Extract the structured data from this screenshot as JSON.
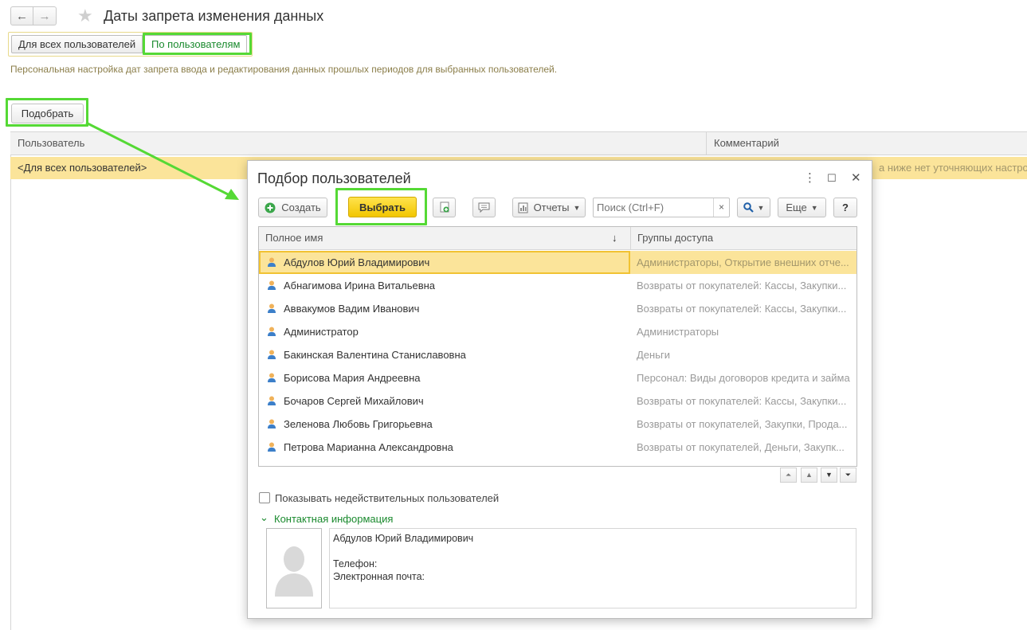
{
  "window": {
    "title": "Даты запрета изменения данных",
    "nav_back": "←",
    "nav_forward": "→",
    "star": "★"
  },
  "mode_switch": {
    "all_users": "Для всех пользователей",
    "by_users": "По пользователям"
  },
  "description": "Персональная настройка дат запрета ввода и редактирования данных прошлых периодов для выбранных пользователей.",
  "pick_button": "Подобрать",
  "main_table": {
    "col_user": "Пользователь",
    "col_comment": "Комментарий",
    "row_user": "<Для всех пользователей>",
    "row_comment": "а ниже нет уточняющих настрое"
  },
  "dialog": {
    "title": "Подбор пользователей",
    "more_icon": "⋮",
    "maximize_icon": "☐",
    "close_icon": "✕",
    "create_label": "Создать",
    "select_label": "Выбрать",
    "reports_label": "Отчеты",
    "search_placeholder": "Поиск (Ctrl+F)",
    "search_clear": "×",
    "more_label": "Еще",
    "help_label": "?",
    "grid": {
      "col_name": "Полное имя",
      "sort_icon": "↓",
      "col_groups": "Группы доступа",
      "rows": [
        {
          "name": "Абдулов Юрий Владимирович",
          "groups": "Администраторы, Открытие внешних отче..."
        },
        {
          "name": "Абнагимова Ирина Витальевна",
          "groups": "Возвраты от покупателей: Кассы, Закупки..."
        },
        {
          "name": "Аввакумов Вадим Иванович",
          "groups": "Возвраты от покупателей: Кассы, Закупки..."
        },
        {
          "name": "Администратор",
          "groups": "Администраторы"
        },
        {
          "name": "Бакинская Валентина Станиславовна",
          "groups": "Деньги"
        },
        {
          "name": "Борисова Мария Андреевна",
          "groups": "Персонал: Виды договоров кредита и займа"
        },
        {
          "name": "Бочаров Сергей Михайлович",
          "groups": "Возвраты от покупателей: Кассы, Закупки..."
        },
        {
          "name": "Зеленова Любовь Григорьевна",
          "groups": "Возвраты от покупателей, Закупки, Прода..."
        },
        {
          "name": "Петрова Марианна Александровна",
          "groups": "Возвраты от покупателей, Деньги, Закупк..."
        }
      ]
    },
    "show_invalid_label": "Показывать недействительных пользователей",
    "contact_section": "Контактная информация",
    "contact": {
      "name": "Абдулов Юрий Владимирович",
      "phone_label": "Телефон:",
      "email_label": "Электронная почта:"
    }
  },
  "colors": {
    "highlight": "#55d935",
    "selected_row": "#fbe49a",
    "primary_button": "#f5d20f",
    "accent_text": "#1a8a2e"
  }
}
